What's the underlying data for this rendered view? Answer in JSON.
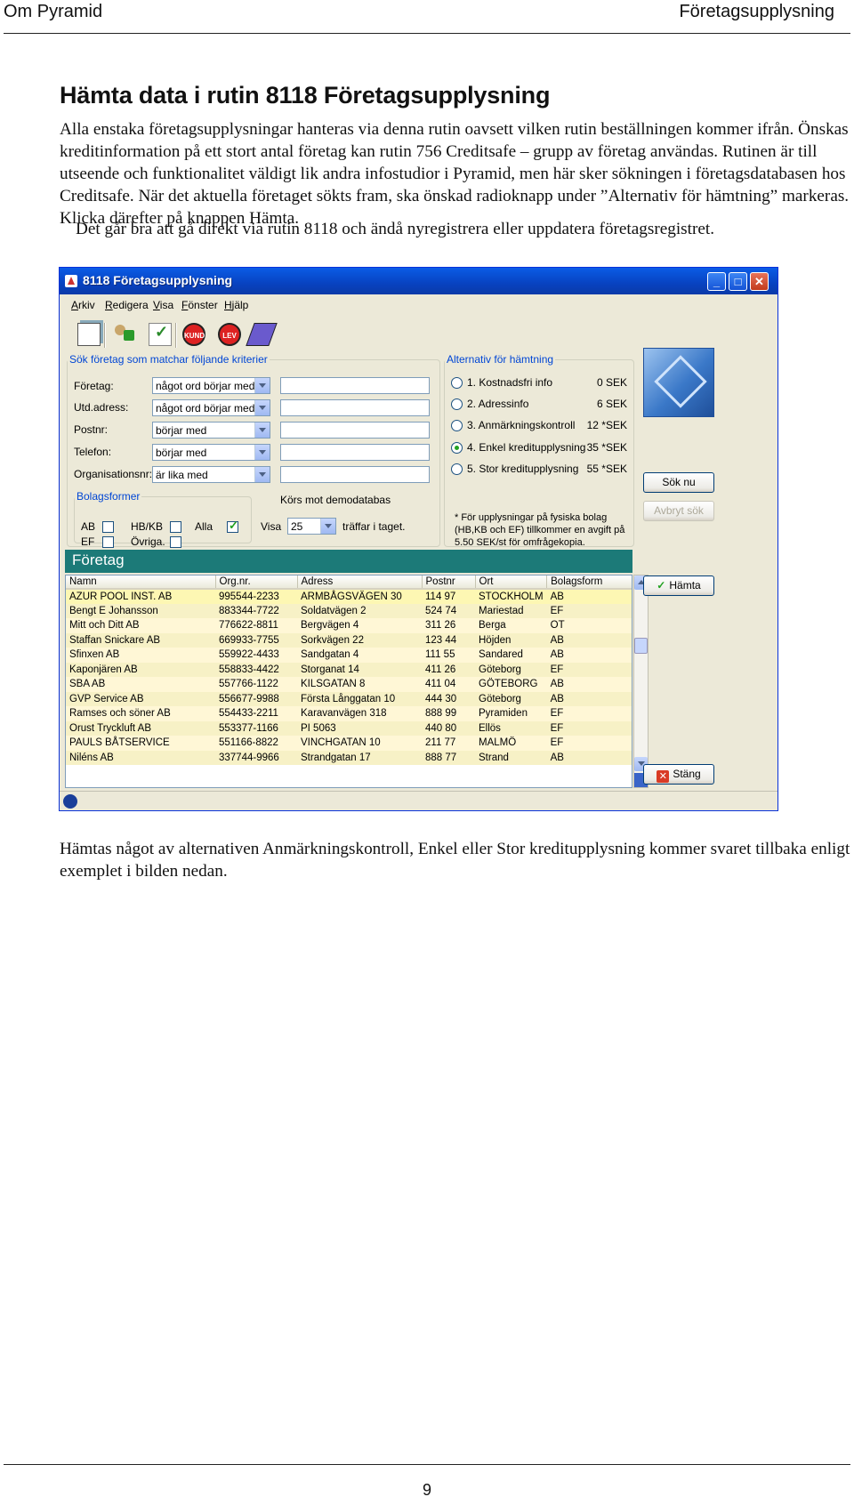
{
  "header": {
    "left": "Om Pyramid",
    "right": "Företagsupplysning"
  },
  "section_title": "Hämta data i rutin 8118 Företagsupplysning",
  "paragraph1": "Alla enstaka företagsupplysningar hanteras via denna rutin oavsett vilken rutin beställningen kommer ifrån. Önskas kreditinformation på ett stort antal företag kan rutin 756 Creditsafe – grupp av företag användas. Rutinen är till utseende och funktionalitet väldigt lik andra infostudior i Pyramid, men här sker sökningen i företagsdatabasen hos Creditsafe. När det aktuella företaget sökts fram, ska önskad radioknapp under ”Alternativ för hämtning” markeras. Klicka därefter på knappen Hämta.",
  "paragraph2": "Det går bra att gå direkt via rutin 8118 och ändå nyregistrera eller uppdatera företagsregistret.",
  "paragraph3": "Hämtas något av alternativen Anmärkningskontroll, Enkel eller Stor kreditupplysning kommer svaret tillbaka enligt exemplet i bilden nedan.",
  "window": {
    "title": "8118 Företagsupplysning",
    "controls": {
      "minimize": "_",
      "maximize": "□",
      "close": "✕"
    },
    "menu": [
      "Arkiv",
      "Redigera",
      "Visa",
      "Fönster",
      "Hjälp"
    ],
    "toolbar_icons": {
      "kund": "KUND",
      "lev": "LEV"
    },
    "search": {
      "legend": "Sök företag som matchar följande kriterier",
      "fields": [
        {
          "label": "Företag:",
          "operator": "något ord börjar med",
          "value": ""
        },
        {
          "label": "Utd.adress:",
          "operator": "något ord börjar med",
          "value": ""
        },
        {
          "label": "Postnr:",
          "operator": "börjar med",
          "value": ""
        },
        {
          "label": "Telefon:",
          "operator": "börjar med",
          "value": ""
        },
        {
          "label": "Organisationsnr:",
          "operator": "är lika med",
          "value": ""
        }
      ]
    },
    "bolagsformer": {
      "legend": "Bolagsformer",
      "ab": "AB",
      "hbkb": "HB/KB",
      "alla": "Alla",
      "ef": "EF",
      "ovriga": "Övriga."
    },
    "demo": {
      "label": "Körs mot demodatabas",
      "visa": "Visa",
      "count": "25",
      "suffix": "träffar i taget."
    },
    "alternatives": {
      "legend": "Alternativ för hämtning",
      "options": [
        {
          "label": "1. Kostnadsfri info",
          "price": "0 SEK",
          "selected": false
        },
        {
          "label": "2. Adressinfo",
          "price": "6 SEK",
          "selected": false
        },
        {
          "label": "3. Anmärkningskontroll",
          "price": "12 *SEK",
          "selected": false
        },
        {
          "label": "4. Enkel kreditupplysning",
          "price": "35 *SEK",
          "selected": true
        },
        {
          "label": "5. Stor kreditupplysning",
          "price": "55 *SEK",
          "selected": false
        }
      ],
      "footnote_line1": "* För upplysningar på fysiska bolag",
      "footnote_line2": "(HB,KB och EF) tillkommer en avgift på",
      "footnote_line3": "5.50 SEK/st för omfrågekopia."
    },
    "buttons": {
      "search": "Sök nu",
      "cancel_search": "Avbryt sök",
      "fetch": "Hämta",
      "close": "Stäng"
    },
    "grid": {
      "title": "Företag",
      "columns": [
        "Namn",
        "Org.nr.",
        "Adress",
        "Postnr",
        "Ort",
        "Bolagsform"
      ],
      "rows": [
        [
          "AZUR POOL INST. AB",
          "995544-2233",
          "ARMBÅGSVÄGEN 30",
          "114 97",
          "STOCKHOLM",
          "AB"
        ],
        [
          "Bengt E Johansson",
          "883344-7722",
          "Soldatvägen 2",
          "524 74",
          "Mariestad",
          "EF"
        ],
        [
          "Mitt och Ditt AB",
          "776622-8811",
          "Bergvägen 4",
          "311 26",
          "Berga",
          "OT"
        ],
        [
          "Staffan Snickare AB",
          "669933-7755",
          "Sorkvägen 22",
          "123 44",
          "Höjden",
          "AB"
        ],
        [
          "Sfinxen AB",
          "559922-4433",
          "Sandgatan 4",
          "111 55",
          "Sandared",
          "AB"
        ],
        [
          "Kaponjären AB",
          "558833-4422",
          "Storganat 14",
          "411 26",
          "Göteborg",
          "EF"
        ],
        [
          "SBA AB",
          "557766-1122",
          "KILSGATAN 8",
          "411 04",
          "GÖTEBORG",
          "AB"
        ],
        [
          "GVP Service AB",
          "556677-9988",
          "Första Långgatan 10",
          "444 30",
          "Göteborg",
          "AB"
        ],
        [
          "Ramses och söner AB",
          "554433-2211",
          "Karavanvägen 318",
          "888 99",
          "Pyramiden",
          "EF"
        ],
        [
          "Orust Tryckluft AB",
          "553377-1166",
          "PI 5063",
          "440 80",
          "Ellös",
          "EF"
        ],
        [
          "PAULS BÅTSERVICE",
          "551166-8822",
          "VINCHGATAN 10",
          "211 77",
          "MALMÖ",
          "EF"
        ],
        [
          "Niléns AB",
          "337744-9966",
          "Strandgatan 17",
          "888 77",
          "Strand",
          "AB"
        ]
      ]
    }
  },
  "page_number": "9"
}
